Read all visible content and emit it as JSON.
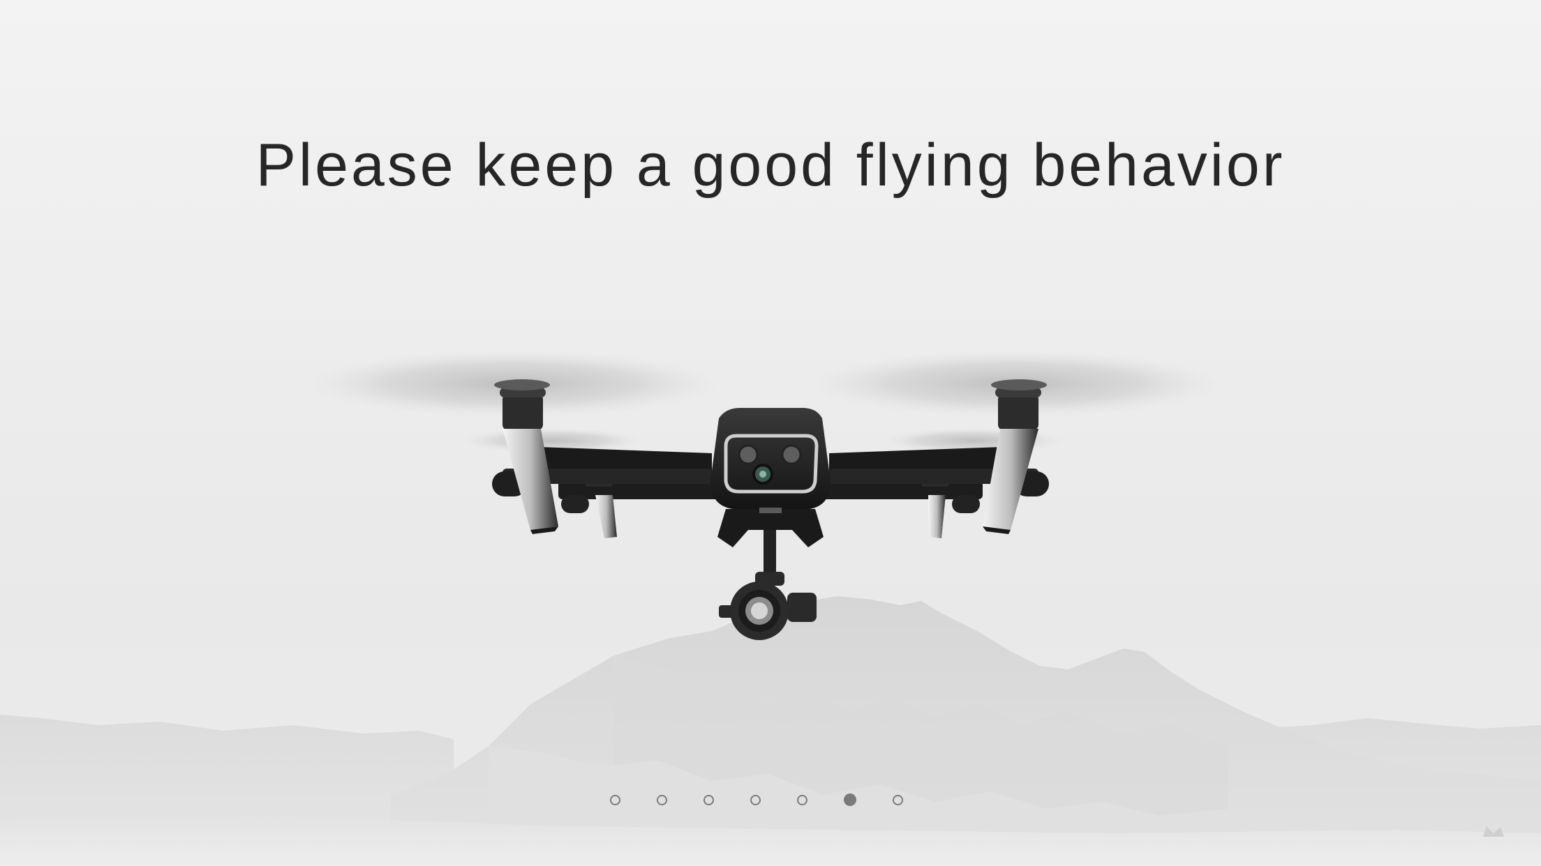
{
  "onboarding": {
    "headline": "Please keep a good flying behavior",
    "page_count": 7,
    "active_page": 6
  },
  "illustration": {
    "subject": "drone-illustration",
    "background": "mountain-landscape"
  },
  "colors": {
    "text": "#262626",
    "dot": "#7a7a7a",
    "background": "#ececec"
  }
}
